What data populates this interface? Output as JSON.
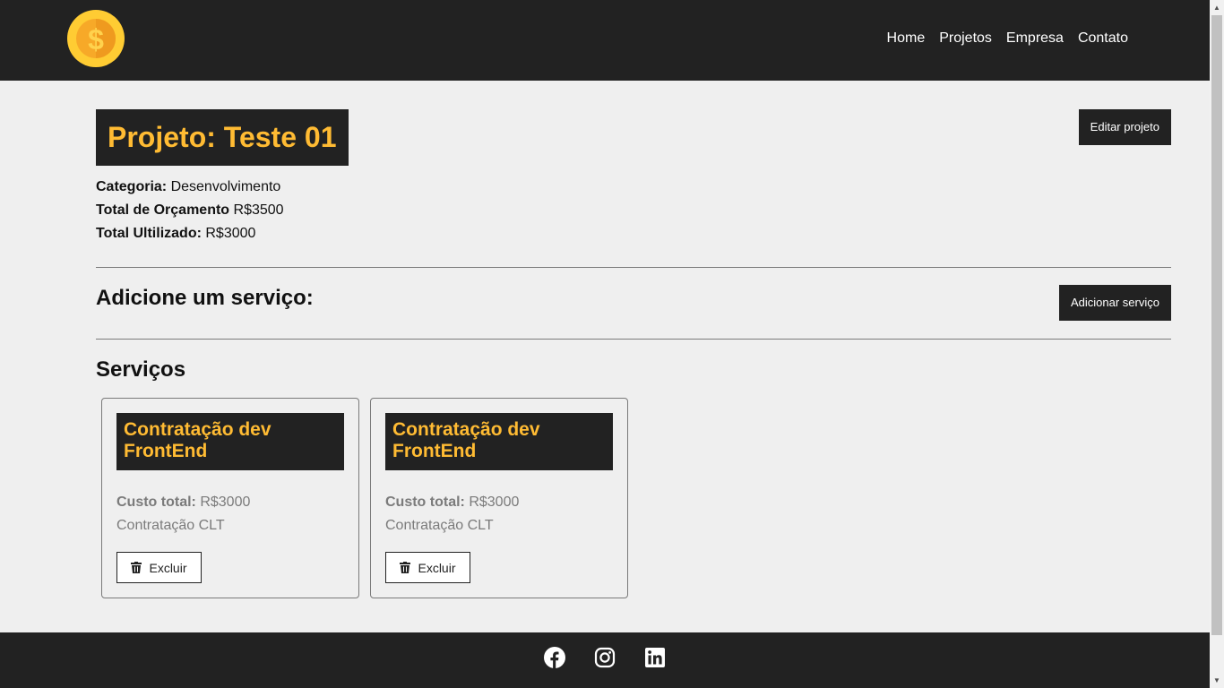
{
  "nav": {
    "logo_icon": "dollar-coin-icon",
    "links": [
      "Home",
      "Projetos",
      "Empresa",
      "Contato"
    ]
  },
  "project": {
    "title": "Projeto: Teste 01",
    "edit_label": "Editar projeto",
    "category_label": "Categoria:",
    "category_value": "Desenvolvimento",
    "budget_label": "Total de Orçamento",
    "budget_value": "R$3500",
    "used_label": "Total Ultilizado:",
    "used_value": "R$3000"
  },
  "add_service": {
    "title": "Adicione um serviço:",
    "button_label": "Adicionar serviço"
  },
  "services": {
    "title": "Serviços",
    "cost_label": "Custo total:",
    "delete_label": "Excluir",
    "items": [
      {
        "name": "Contratação dev FrontEnd",
        "cost": "R$3000",
        "description": "Contratação CLT"
      },
      {
        "name": "Contratação dev FrontEnd",
        "cost": "R$3000",
        "description": "Contratação CLT"
      }
    ]
  },
  "footer": {
    "icons": [
      "facebook-icon",
      "instagram-icon",
      "linkedin-icon"
    ]
  },
  "colors": {
    "dark": "#222222",
    "accent": "#ffbb33",
    "background": "#efefef"
  }
}
